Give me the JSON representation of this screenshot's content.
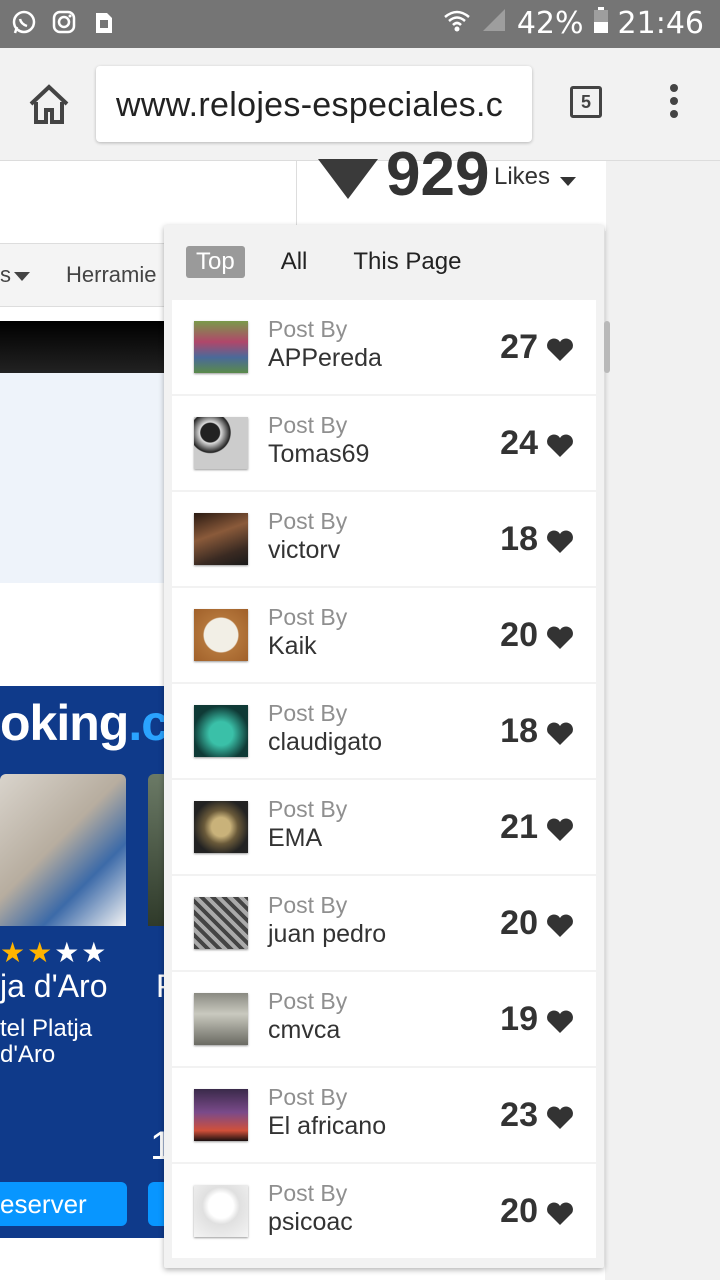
{
  "status_bar": {
    "battery": "42%",
    "time": "21:46"
  },
  "browser": {
    "url": "www.relojes-especiales.c",
    "tab_count": "5"
  },
  "likes": {
    "count": "929",
    "label": "Likes"
  },
  "nav": {
    "partial_item": "s",
    "herramientas": "Herramie"
  },
  "ad": {
    "brand": "oking",
    "brand_dot": ".c",
    "stars_gold": "★★",
    "stars_white": "★★",
    "title": "ja d'Aro",
    "title2": "P",
    "subtitle": "tel Platja d'Aro",
    "price": "1",
    "button": "eserver"
  },
  "dropdown": {
    "tabs": [
      "Top",
      "All",
      "This Page"
    ],
    "post_by_label": "Post By",
    "items": [
      {
        "user": "APPereda",
        "count": "27"
      },
      {
        "user": "Tomas69",
        "count": "24"
      },
      {
        "user": "victorv",
        "count": "18"
      },
      {
        "user": "Kaik",
        "count": "20"
      },
      {
        "user": "claudigato",
        "count": "18"
      },
      {
        "user": "EMA",
        "count": "21"
      },
      {
        "user": "juan pedro",
        "count": "20"
      },
      {
        "user": "cmvca",
        "count": "19"
      },
      {
        "user": "El africano",
        "count": "23"
      },
      {
        "user": "psicoac",
        "count": "20"
      }
    ]
  },
  "colors": {
    "status_bar": "#757575",
    "ad_background": "#0f3a8a",
    "ad_button": "#0896ff",
    "active_tab": "#9a9a9a"
  }
}
